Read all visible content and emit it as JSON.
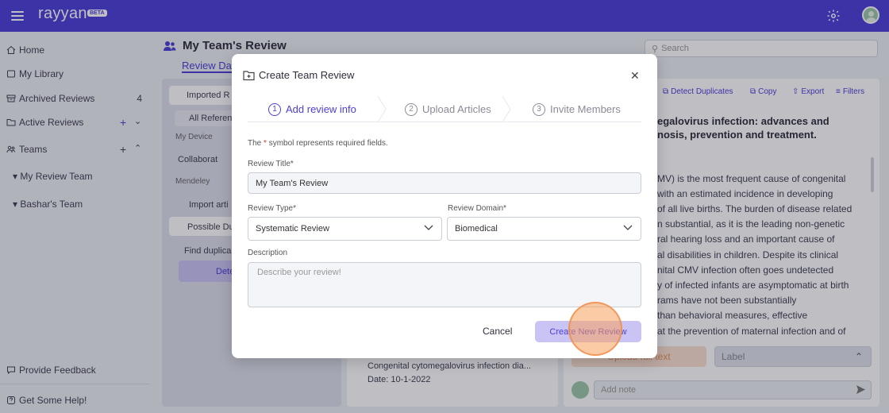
{
  "app": {
    "name": "rayyan",
    "badge": "BETA"
  },
  "sidebar": {
    "home": "Home",
    "library": "My Library",
    "archived": "Archived Reviews",
    "archived_count": "4",
    "active": "Active Reviews",
    "teams": "Teams",
    "team_items": [
      "My Review Team",
      "Bashar's Team"
    ],
    "feedback": "Provide Feedback",
    "help": "Get Some Help!"
  },
  "background": {
    "page_title": "My Team's Review",
    "tab": "Review Dat",
    "search_placeholder": "Search",
    "left_panel": {
      "imported": "Imported R",
      "all_refs": "All Referen",
      "my_device": "My Device",
      "collaborat": "Collaborat",
      "mendeley": "Mendeley",
      "import_art": "Import arti",
      "possible": "Possible Du",
      "find_dup": "Find duplica",
      "detect": "Detec"
    },
    "toolbar": {
      "detect": "Detect Duplicates",
      "copy": "Copy",
      "export": "Export",
      "filters": "Filters"
    },
    "article_title": [
      "egalovirus infection: advances and",
      "nosis, prevention and treatment."
    ],
    "abstract_lines": [
      "MV) is the most frequent cause of congenital",
      "with an estimated incidence in developing",
      "of all live births. The burden of disease related",
      "n substantial, as it is the leading non-genetic",
      "ral hearing loss and an important cause of",
      "al disabilities in children. Despite its clinical",
      "nital CMV infection often goes undetected",
      "y of infected infants are asymptomatic at birth",
      "rams have not been substantially",
      "than behavioral measures, effective",
      "at the prevention of maternal infection and of"
    ],
    "mid_item_title": "Congenital cytomegalovirus infection dia...",
    "mid_item_date": "Date: 10-1-2022",
    "upload_label": "Upload full text",
    "label_placeholder": "Label",
    "note_placeholder": "Add note"
  },
  "modal": {
    "title": "Create Team Review",
    "steps": [
      {
        "num": "1",
        "label": "Add review info"
      },
      {
        "num": "2",
        "label": "Upload Articles"
      },
      {
        "num": "3",
        "label": "Invite Members"
      }
    ],
    "required_note_pre": "The ",
    "required_note_star": "*",
    "required_note_post": " symbol represents required fields.",
    "review_title_label": "Review Title*",
    "review_title_value": "My Team's Review",
    "review_type_label": "Review Type*",
    "review_type_value": "Systematic Review",
    "review_domain_label": "Review Domain*",
    "review_domain_value": "Biomedical",
    "description_label": "Description",
    "description_placeholder": "Describe your review!",
    "cancel": "Cancel",
    "create": "Create New Review"
  },
  "colors": {
    "brand": "#4b3fd8",
    "accent_orange": "#f7a05c"
  }
}
